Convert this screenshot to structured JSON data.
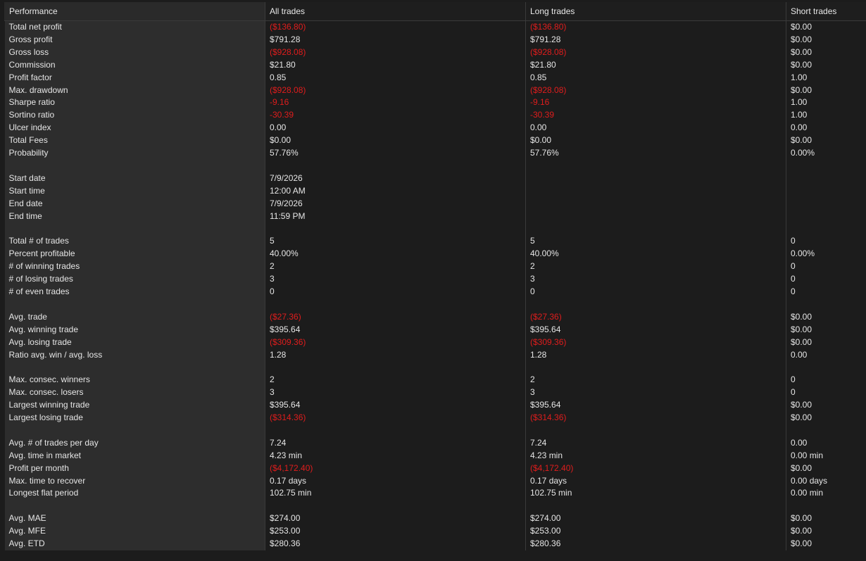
{
  "headers": [
    "Performance",
    "All trades",
    "Long trades",
    "Short trades"
  ],
  "colors": {
    "negative": "#e01c1c",
    "label_bg": "#2d2d2d",
    "bg": "#1c1c1c",
    "text": "#e6e6e6"
  },
  "rows": [
    [
      "Total net profit",
      "($136.80)",
      "($136.80)",
      "$0.00"
    ],
    [
      "Gross profit",
      "$791.28",
      "$791.28",
      "$0.00"
    ],
    [
      "Gross loss",
      "($928.08)",
      "($928.08)",
      "$0.00"
    ],
    [
      "Commission",
      "$21.80",
      "$21.80",
      "$0.00"
    ],
    [
      "Profit factor",
      "0.85",
      "0.85",
      "1.00"
    ],
    [
      "Max. drawdown",
      "($928.08)",
      "($928.08)",
      "$0.00"
    ],
    [
      "Sharpe ratio",
      "-9.16",
      "-9.16",
      "1.00"
    ],
    [
      "Sortino ratio",
      "-30.39",
      "-30.39",
      "1.00"
    ],
    [
      "Ulcer index",
      "0.00",
      "0.00",
      "0.00"
    ],
    [
      "Total Fees",
      "$0.00",
      "$0.00",
      "$0.00"
    ],
    [
      "Probability",
      "57.76%",
      "57.76%",
      "0.00%"
    ],
    [
      "",
      "",
      "",
      ""
    ],
    [
      "Start date",
      "7/9/2026",
      "",
      ""
    ],
    [
      "Start time",
      "12:00 AM",
      "",
      ""
    ],
    [
      "End date",
      "7/9/2026",
      "",
      ""
    ],
    [
      "End time",
      "11:59 PM",
      "",
      ""
    ],
    [
      "",
      "",
      "",
      ""
    ],
    [
      "Total # of trades",
      "5",
      "5",
      "0"
    ],
    [
      "Percent profitable",
      "40.00%",
      "40.00%",
      "0.00%"
    ],
    [
      "# of winning trades",
      "2",
      "2",
      "0"
    ],
    [
      "# of losing trades",
      "3",
      "3",
      "0"
    ],
    [
      "# of even trades",
      "0",
      "0",
      "0"
    ],
    [
      "",
      "",
      "",
      ""
    ],
    [
      "Avg. trade",
      "($27.36)",
      "($27.36)",
      "$0.00"
    ],
    [
      "Avg. winning trade",
      "$395.64",
      "$395.64",
      "$0.00"
    ],
    [
      "Avg. losing trade",
      "($309.36)",
      "($309.36)",
      "$0.00"
    ],
    [
      "Ratio avg. win / avg. loss",
      "1.28",
      "1.28",
      "0.00"
    ],
    [
      "",
      "",
      "",
      ""
    ],
    [
      "Max. consec. winners",
      "2",
      "2",
      "0"
    ],
    [
      "Max. consec. losers",
      "3",
      "3",
      "0"
    ],
    [
      "Largest winning trade",
      "$395.64",
      "$395.64",
      "$0.00"
    ],
    [
      "Largest losing trade",
      "($314.36)",
      "($314.36)",
      "$0.00"
    ],
    [
      "",
      "",
      "",
      ""
    ],
    [
      "Avg. # of trades per day",
      "7.24",
      "7.24",
      "0.00"
    ],
    [
      "Avg. time in market",
      "4.23 min",
      "4.23 min",
      "0.00 min"
    ],
    [
      "Profit per month",
      "($4,172.40)",
      "($4,172.40)",
      "$0.00"
    ],
    [
      "Max. time to recover",
      "0.17 days",
      "0.17 days",
      "0.00 days"
    ],
    [
      "Longest flat period",
      "102.75 min",
      "102.75 min",
      "0.00 min"
    ],
    [
      "",
      "",
      "",
      ""
    ],
    [
      "Avg. MAE",
      "$274.00",
      "$274.00",
      "$0.00"
    ],
    [
      "Avg. MFE",
      "$253.00",
      "$253.00",
      "$0.00"
    ],
    [
      "Avg. ETD",
      "$280.36",
      "$280.36",
      "$0.00"
    ]
  ]
}
